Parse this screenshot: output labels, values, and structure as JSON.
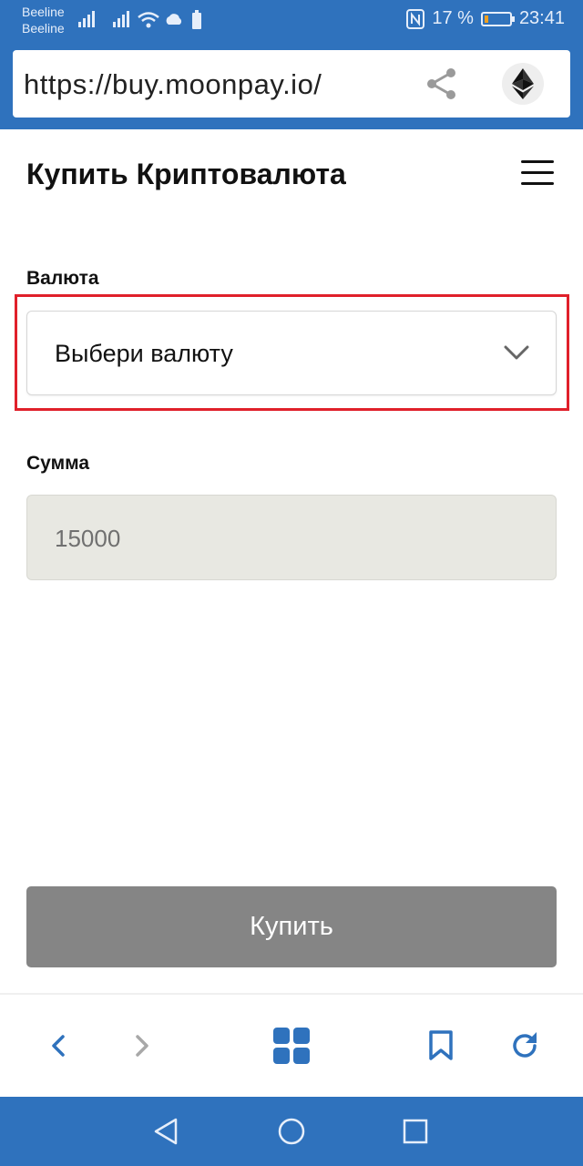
{
  "status_bar": {
    "carrier_1": "Beeline",
    "carrier_2": "Beeline",
    "battery_percent": "17 %",
    "time": "23:41",
    "battery_level": 0.17
  },
  "browser": {
    "url": "https://buy.moonpay.io/"
  },
  "page": {
    "title": "Купить Криптовалюта"
  },
  "form": {
    "currency_label": "Валюта",
    "currency_placeholder": "Выбери валюту",
    "amount_label": "Сумма",
    "amount_value": "15000",
    "buy_label": "Купить"
  },
  "colors": {
    "chrome_blue": "#2f72bd",
    "highlight_red": "#e0202a",
    "toolbar_icon_blue": "#2f72bd",
    "button_gray": "#858585"
  }
}
